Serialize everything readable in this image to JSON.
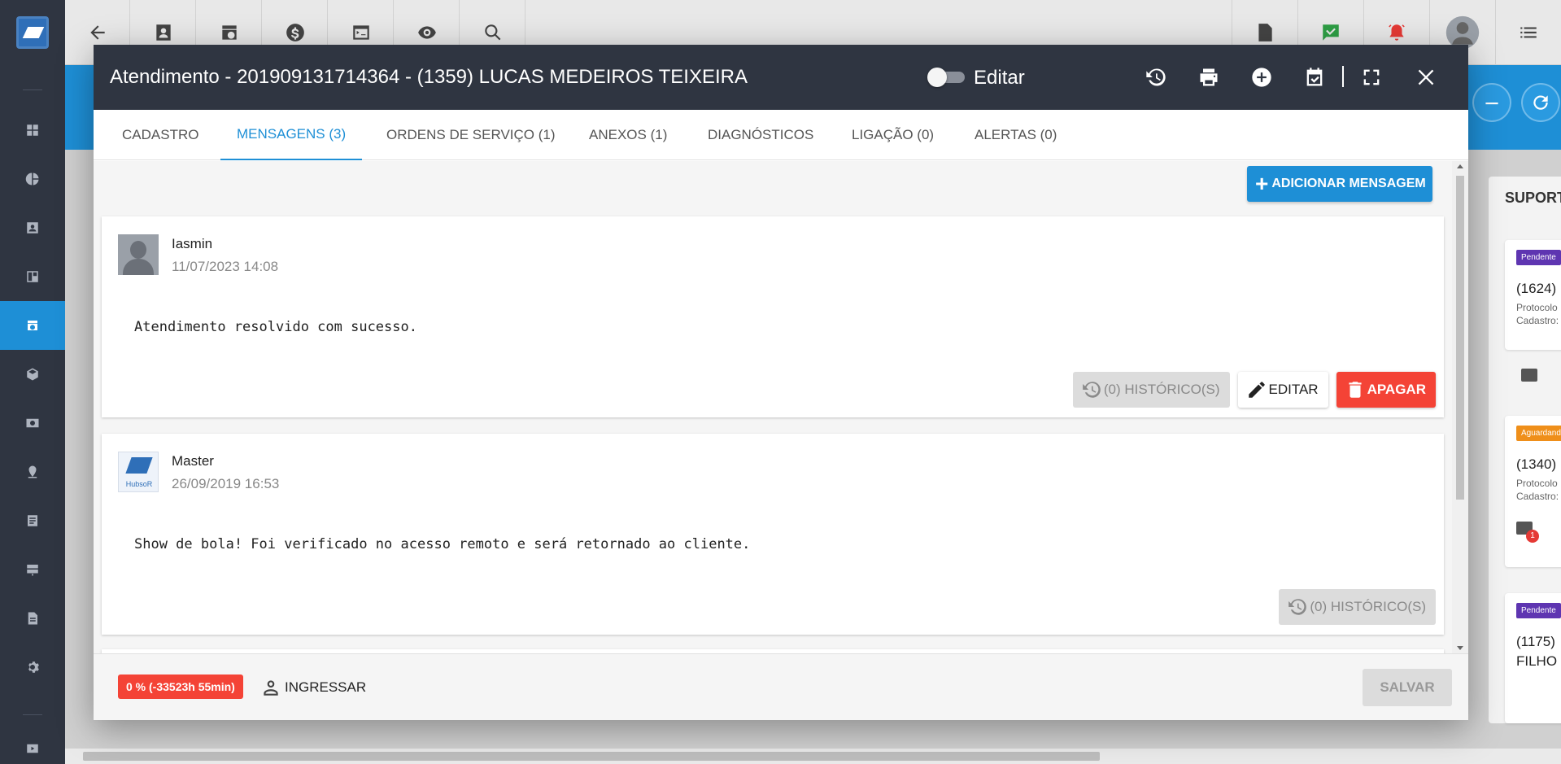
{
  "app": {
    "right_panel": {
      "title": "SUPORT",
      "cards": [
        {
          "badge": "Pendente",
          "badge_color": "#5e35b1",
          "line1": "(1624)",
          "line2": "Protocolo",
          "line3": "Cadastro:"
        },
        {
          "badge": "Aguardand",
          "badge_color": "#ef8f1a",
          "line1": "(1340)",
          "line2": "Protocolo",
          "line3": "Cadastro:",
          "count": "1"
        },
        {
          "badge": "Pendente",
          "badge_color": "#5e35b1",
          "line1": "(1175)",
          "line2": "FILHO"
        }
      ]
    }
  },
  "modal": {
    "title": "Atendimento - 201909131714364 - (1359) LUCAS MEDEIROS TEIXEIRA",
    "edit_toggle_label": "Editar",
    "edit_toggle_on": false,
    "tabs": [
      {
        "label": "CADASTRO",
        "active": false
      },
      {
        "label": "MENSAGENS (3)",
        "active": true
      },
      {
        "label": "ORDENS DE SERVIÇO (1)",
        "active": false
      },
      {
        "label": "ANEXOS (1)",
        "active": false
      },
      {
        "label": "DIAGNÓSTICOS",
        "active": false
      },
      {
        "label": "LIGAÇÃO (0)",
        "active": false
      },
      {
        "label": "ALERTAS (0)",
        "active": false
      }
    ],
    "add_message_label": "ADICIONAR MENSAGEM",
    "messages": [
      {
        "author": "Iasmin",
        "date": "11/07/2023 14:08",
        "text": "Atendimento resolvido com sucesso.",
        "history_label": "(0) HISTÓRICO(S)",
        "edit_label": "EDITAR",
        "delete_label": "APAGAR"
      },
      {
        "author": "Master",
        "avatar_text": "HubsoR",
        "date": "26/09/2019 16:53",
        "text": "Show de bola! Foi verificado no acesso remoto e será retornado ao cliente.",
        "history_label": "(0) HISTÓRICO(S)"
      }
    ],
    "footer": {
      "timer_badge": "0 % (-33523h 55min)",
      "join_label": "INGRESSAR",
      "save_label": "SALVAR"
    }
  },
  "colors": {
    "accent": "#1e8fd6",
    "header_bg": "#2f3541",
    "danger": "#f44336"
  }
}
